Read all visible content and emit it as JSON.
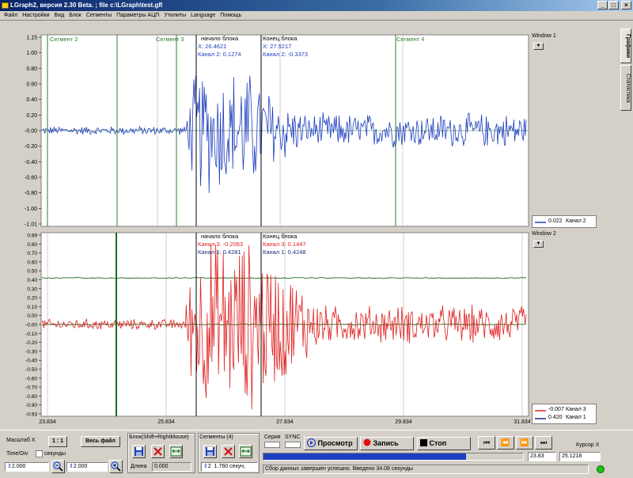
{
  "window": {
    "title": "LGraph2, версия  2.30 Beta. ; file c:\\LGraph\\test.gfl",
    "min_glyph": "_",
    "max_glyph": "□",
    "close_glyph": "×"
  },
  "menu": [
    "Файл",
    "Настройки",
    "Вид",
    "Блок",
    "Сегменты",
    "Параметры АЦП",
    "Утилиты",
    "Language",
    "Помощь"
  ],
  "tabs": [
    "Графики",
    "Статистика"
  ],
  "plot1": {
    "y_ticks": [
      "1.15",
      "1.00",
      "0.80",
      "0.60",
      "0.40",
      "0.20",
      "-0.00",
      "-0.20",
      "-0.40",
      "-0.60",
      "-0.80",
      "-1.00",
      "-1.01"
    ],
    "segment_labels": [
      "Сегмент 2",
      "Сегмент 3",
      "Сегмент 4"
    ],
    "block_start": {
      "title": "начало блока",
      "x": "X: 26.4621",
      "ch": "Канал 2: 0.1274"
    },
    "block_end": {
      "title": "Конец блока",
      "x": "X: 27.5217",
      "ch": "Канал 2: -0.3373"
    }
  },
  "plot2": {
    "y_ticks": [
      "0.89",
      "0.80",
      "0.70",
      "0.60",
      "0.50",
      "0.40",
      "0.30",
      "0.20",
      "0.10",
      "0.00",
      "-0.00",
      "-0.10",
      "-0.20",
      "-0.30",
      "-0.40",
      "-0.50",
      "-0.60",
      "-0.70",
      "-0.80",
      "-0.90",
      "-0.93"
    ],
    "x_ticks": [
      "23.834",
      "25.834",
      "27.834",
      "29.834",
      "31.834"
    ],
    "block_start": {
      "title": "начало блока",
      "ch3": "Канал 3: -0.2063",
      "ch1": "Канал 1: 0.4281"
    },
    "block_end": {
      "title": "Конец блока",
      "ch3": "Канал 3: 0.1447",
      "ch1": "Канал 1: 0.4248"
    }
  },
  "side": {
    "window1": "Window 1",
    "window2": "Window 2",
    "legend1": [
      {
        "value": "0.022",
        "name": "Канал 2",
        "color": "#1f3fbf"
      }
    ],
    "legend2": [
      {
        "value": "-0.007",
        "name": "Канал 3",
        "color": "#e02020"
      },
      {
        "value": "0.420",
        "name": "Канал 1",
        "color": "#1a2a80"
      }
    ]
  },
  "controls": {
    "scale_x": "Масштаб X",
    "one_to_one": "1 : 1",
    "whole_file": "Весь файл",
    "time_div": "Time/Div",
    "unit": "секунды",
    "field_a": "2.000",
    "field_b": "2.000",
    "block_group": "Блок(Shift+RightMouse)",
    "length_label": "Длина",
    "length_value": "0.000",
    "segments_group": "Сегменты (4)",
    "seg_num": "2",
    "seg_value": "1.760 секун,",
    "series": "Серия",
    "sync": "SYNC",
    "view_btn": "Просмотр",
    "record_btn": "Запись",
    "stop_btn": "Стоп",
    "pos_value": "23.83",
    "cursor_label": "Курсор X",
    "cursor_value": "25.1218",
    "status": "Сбор данных завершен успешно. Введено 34.08 секунды",
    "progress": 0.78
  },
  "colors": {
    "ch2": "#1f3fbf",
    "ch3": "#e02020",
    "ch1": "#1a6a1a",
    "segment": "#2e7d32",
    "progress": "#1f3fbf"
  }
}
